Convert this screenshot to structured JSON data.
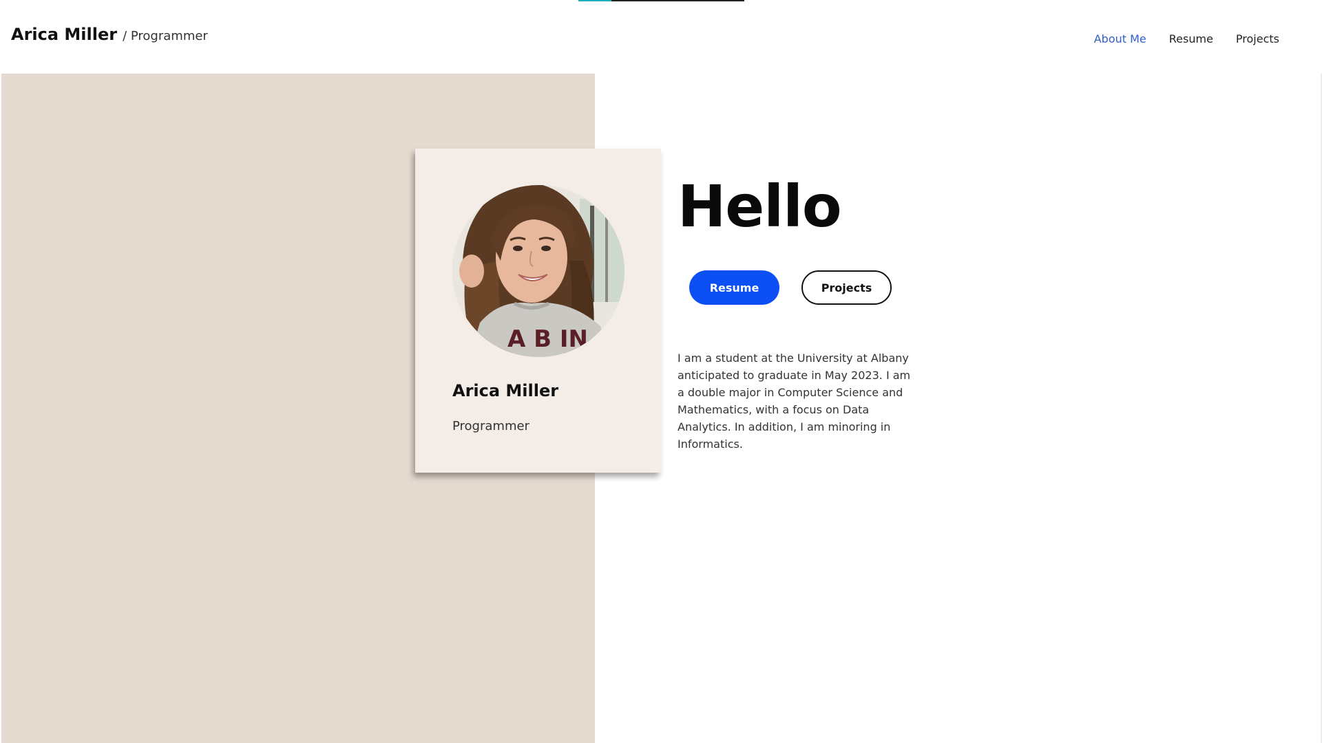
{
  "header": {
    "brand_name": "Arica Miller",
    "brand_separator": "/ Programmer",
    "nav": [
      {
        "label": "About Me",
        "active": true
      },
      {
        "label": "Resume",
        "active": false
      },
      {
        "label": "Projects",
        "active": false
      }
    ]
  },
  "top_loading_bar": {
    "progress": 0.2,
    "color": "#1ab0c0"
  },
  "profile_card": {
    "name": "Arica Miller",
    "title": "Programmer",
    "avatar_icon": "profile-photo"
  },
  "hero": {
    "heading": "Hello",
    "primary_button_label": "Resume",
    "secondary_button_label": "Projects",
    "bio": "I am a student at the University at Albany anticipated to graduate in May 2023. I am a double major in Computer Science and Mathematics, with a focus on Data Analytics. In addition, I am minoring in Informatics."
  },
  "colors": {
    "accent": "#0b4ff5",
    "nav_active": "#2f5fd0",
    "beige_panel": "#e5dad0",
    "card_bg": "#f3ece7"
  }
}
